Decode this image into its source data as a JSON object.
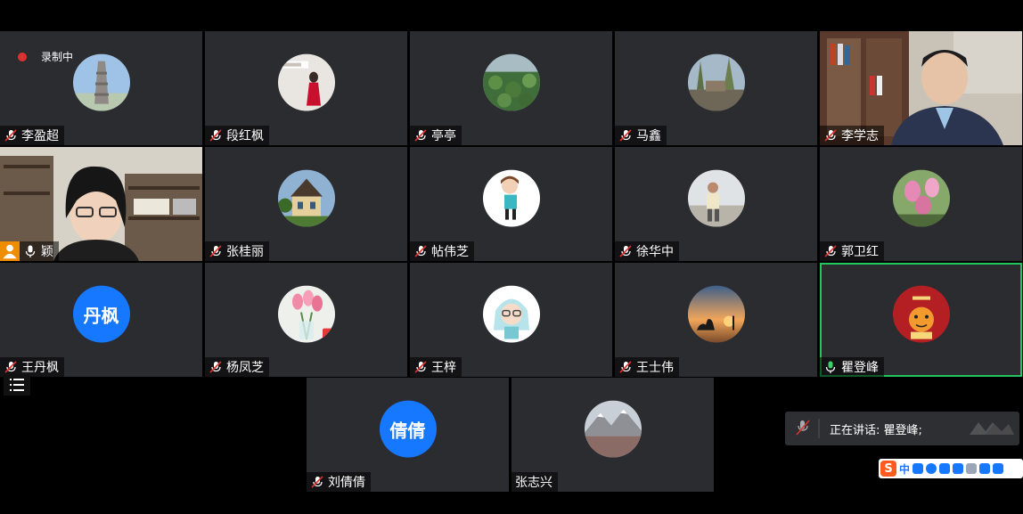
{
  "recording": {
    "label": "录制中"
  },
  "participants": {
    "r1c1": {
      "name": "李盈超"
    },
    "r1c2": {
      "name": "段红枫"
    },
    "r1c3": {
      "name": "亭亭"
    },
    "r1c4": {
      "name": "马鑫"
    },
    "r1c5": {
      "name": "李学志"
    },
    "r2c1": {
      "name": "颖"
    },
    "r2c2": {
      "name": "张桂丽"
    },
    "r2c3": {
      "name": "帖伟芝"
    },
    "r2c4": {
      "name": "徐华中"
    },
    "r2c5": {
      "name": "郭卫红"
    },
    "r3c1": {
      "name": "王丹枫",
      "avatar_text": "丹枫"
    },
    "r3c2": {
      "name": "杨凤芝"
    },
    "r3c3": {
      "name": "王梓"
    },
    "r3c4": {
      "name": "王士伟"
    },
    "r3c5": {
      "name": "瞿登峰"
    },
    "r4c1": {
      "name": "刘倩倩",
      "avatar_text": "倩倩"
    },
    "r4c2": {
      "name": "张志兴"
    }
  },
  "speaking_indicator": {
    "text": "正在讲话: 瞿登峰;"
  },
  "ime_toolbar": {
    "label": "中"
  },
  "colors": {
    "tile_bg": "#2b2c30",
    "active_border": "#22c55e",
    "avatar_blue": "#1677ff",
    "record_red": "#e03131"
  },
  "icons": [
    "microphone-muted-icon",
    "microphone-icon",
    "record-icon",
    "list-icon",
    "person-icon",
    "speaker-muted-icon"
  ]
}
